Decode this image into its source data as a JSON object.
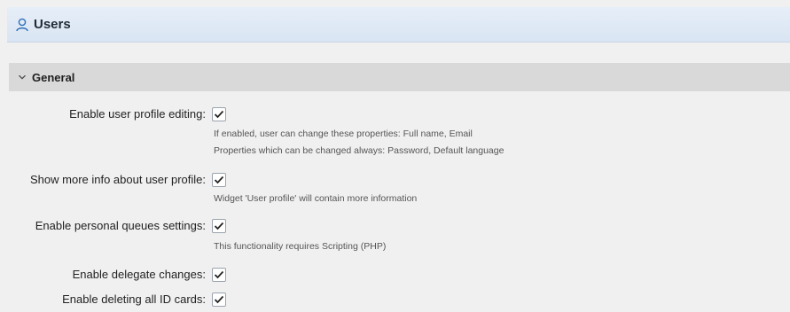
{
  "header": {
    "title": "Users",
    "icon": "user-icon"
  },
  "section": {
    "title": "General",
    "icon": "chevron-down-icon"
  },
  "settings": [
    {
      "label": "Enable user profile editing:",
      "checked": true,
      "hints": [
        "If enabled, user can change these properties: Full name, Email",
        "Properties which can be changed always: Password, Default language"
      ]
    },
    {
      "label": "Show more info about user profile:",
      "checked": true,
      "hints": [
        "Widget 'User profile' will contain more information"
      ]
    },
    {
      "label": "Enable personal queues settings:",
      "checked": true,
      "hints": [
        "This functionality requires Scripting (PHP)"
      ]
    },
    {
      "label": "Enable delegate changes:",
      "checked": true,
      "hints": []
    },
    {
      "label": "Enable deleting all ID cards:",
      "checked": true,
      "hints": []
    }
  ],
  "colors": {
    "header_bg": "#dde8f4",
    "section_bg": "#d9d9d9",
    "page_bg": "#f0f0f0"
  }
}
